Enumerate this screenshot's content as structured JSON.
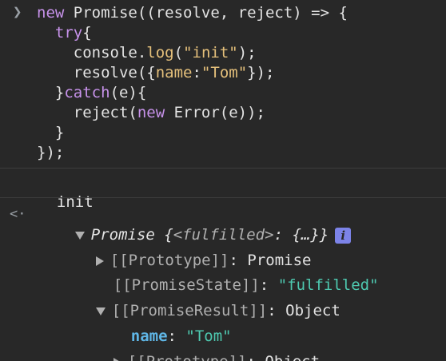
{
  "input": {
    "prompt_icon": "chevron-right-icon",
    "lines": [
      {
        "parts": [
          {
            "t": "new",
            "c": "kw"
          },
          {
            "t": " Promise((resolve, reject) => {",
            "c": "punct"
          }
        ]
      },
      {
        "parts": [
          {
            "t": "  try",
            "c": "kw"
          },
          {
            "t": "{",
            "c": "punct"
          }
        ]
      },
      {
        "parts": [
          {
            "t": "    console.",
            "c": "punct"
          },
          {
            "t": "log",
            "c": "fn"
          },
          {
            "t": "(",
            "c": "punct"
          },
          {
            "t": "\"init\"",
            "c": "fn"
          },
          {
            "t": ");",
            "c": "punct"
          }
        ]
      },
      {
        "parts": [
          {
            "t": "    resolve({",
            "c": "punct"
          },
          {
            "t": "name",
            "c": "fn"
          },
          {
            "t": ":",
            "c": "punct"
          },
          {
            "t": "\"Tom\"",
            "c": "fn"
          },
          {
            "t": "});",
            "c": "punct"
          }
        ]
      },
      {
        "parts": [
          {
            "t": "  }",
            "c": "punct"
          },
          {
            "t": "catch",
            "c": "kw"
          },
          {
            "t": "(e){",
            "c": "punct"
          }
        ]
      },
      {
        "parts": [
          {
            "t": "    reject(",
            "c": "punct"
          },
          {
            "t": "new",
            "c": "kw"
          },
          {
            "t": " Error(e));",
            "c": "punct"
          }
        ]
      },
      {
        "parts": [
          {
            "t": "  }",
            "c": "punct"
          }
        ]
      },
      {
        "parts": [
          {
            "t": "});",
            "c": "punct"
          }
        ]
      }
    ]
  },
  "log_output": "init",
  "result": {
    "return_icon": "return-value-icon",
    "summary_type": "Promise",
    "summary_open": " {",
    "summary_state": "<fulfilled>",
    "summary_colon": ": ",
    "summary_value": "{…}",
    "summary_close": "}",
    "info_label": "i",
    "rows": {
      "prototype": {
        "key": "[[Prototype]]",
        "sep": ": ",
        "value": "Promise"
      },
      "state": {
        "key": "[[PromiseState]]",
        "sep": ": ",
        "value": "\"fulfilled\""
      },
      "result": {
        "key": "[[PromiseResult]]",
        "sep": ": ",
        "value": "Object"
      },
      "name": {
        "key": "name",
        "sep": ": ",
        "value": "\"Tom\""
      },
      "inner_prototype": {
        "key": "[[Prototype]]",
        "sep": ": ",
        "value": "Object"
      }
    }
  }
}
